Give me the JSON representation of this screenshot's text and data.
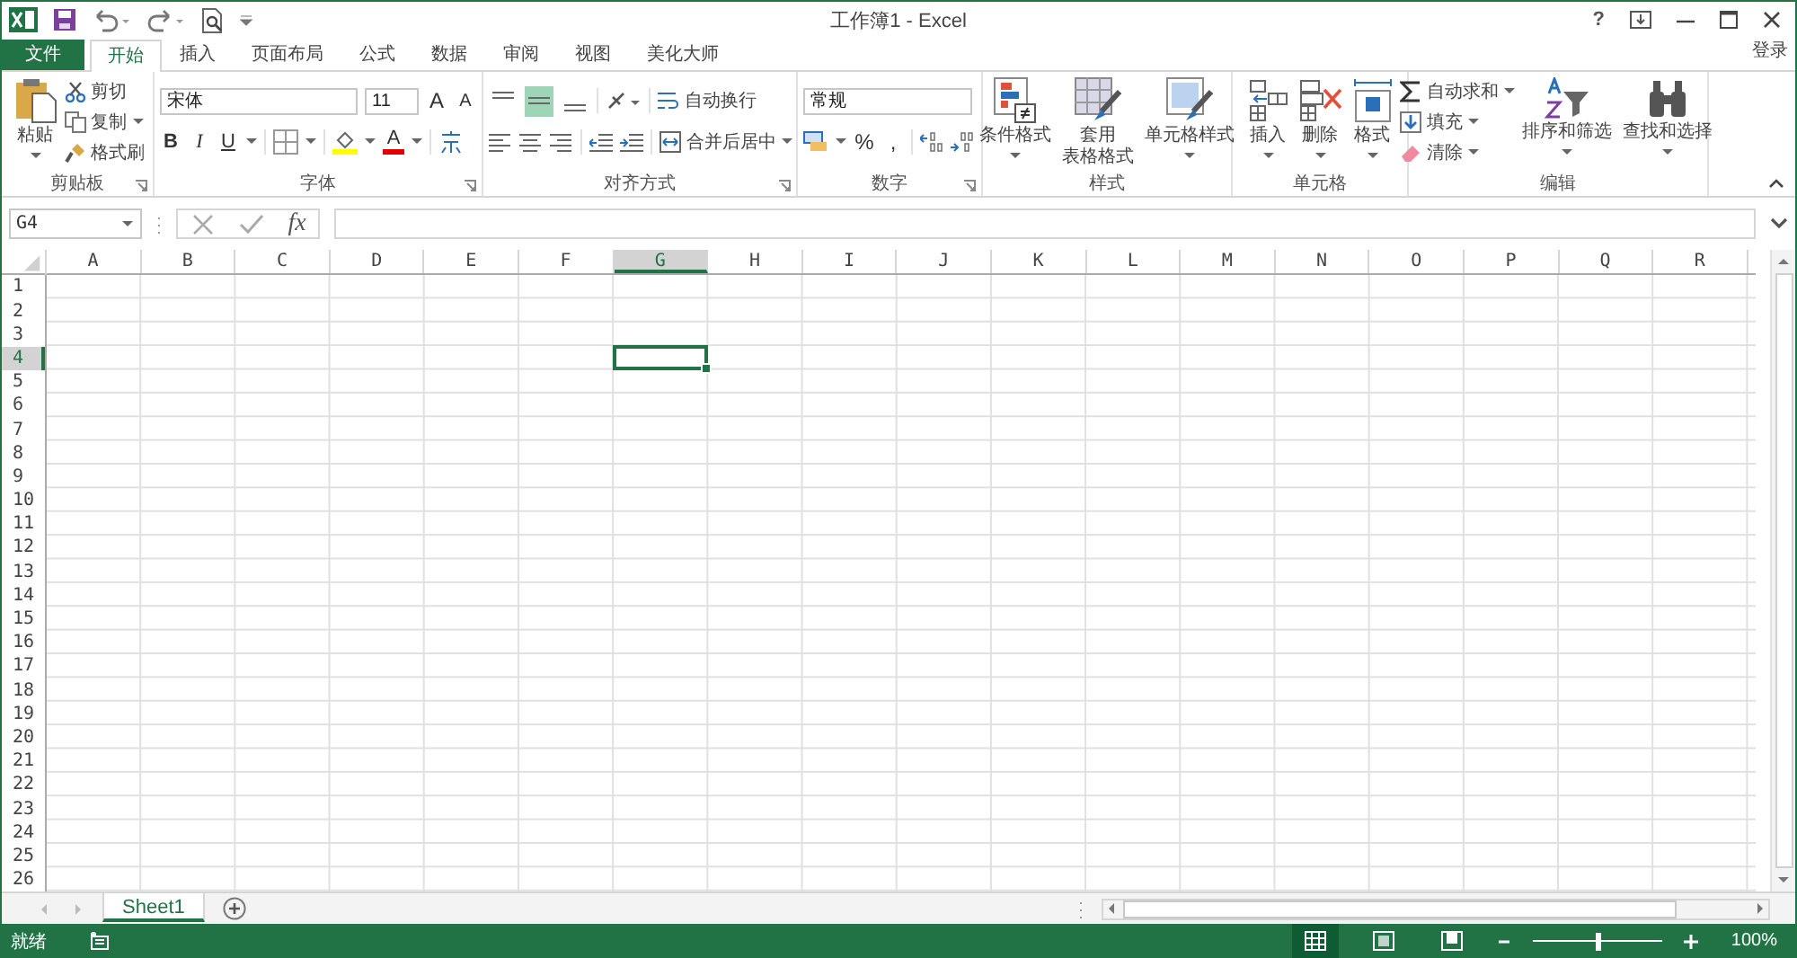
{
  "window": {
    "title": "工作簿1 - Excel",
    "help": "?",
    "signin": "登录"
  },
  "tabs": [
    {
      "label": "文件",
      "kind": "file",
      "selected": false
    },
    {
      "label": "开始",
      "kind": "tab",
      "selected": true
    },
    {
      "label": "插入",
      "kind": "tab",
      "selected": false
    },
    {
      "label": "页面布局",
      "kind": "tab",
      "selected": false
    },
    {
      "label": "公式",
      "kind": "tab",
      "selected": false
    },
    {
      "label": "数据",
      "kind": "tab",
      "selected": false
    },
    {
      "label": "审阅",
      "kind": "tab",
      "selected": false
    },
    {
      "label": "视图",
      "kind": "tab",
      "selected": false
    },
    {
      "label": "美化大师",
      "kind": "tab",
      "selected": false
    }
  ],
  "clipboard": {
    "label": "剪贴板",
    "paste": "粘贴",
    "cut": "剪切",
    "copy": "复制",
    "format_painter": "格式刷"
  },
  "font": {
    "label": "字体",
    "font_name": "宋体",
    "font_size": "11",
    "grow": "A",
    "shrink": "A",
    "bold": "B",
    "italic": "I",
    "underline": "U",
    "font_color": "A"
  },
  "alignment": {
    "label": "对齐方式",
    "vertical": [
      {
        "kind": "top",
        "selected": false
      },
      {
        "kind": "middle",
        "selected": true
      },
      {
        "kind": "bottom",
        "selected": false
      }
    ],
    "wrap": "自动换行",
    "merge": "合并后居中"
  },
  "number": {
    "label": "数字",
    "format": "常规",
    "percent": "%",
    "comma": ","
  },
  "styles": {
    "label": "样式",
    "conditional": "条件格式",
    "table": [
      "套用",
      "表格格式"
    ],
    "cell_styles": "单元格样式"
  },
  "cells": {
    "label": "单元格",
    "insert": "插入",
    "delete": "删除",
    "format": "格式"
  },
  "editing": {
    "label": "编辑",
    "autosum": "自动求和",
    "fill": "填充",
    "clear": "清除",
    "sort": "排序和筛选",
    "find": "查找和选择"
  },
  "formula_bar": {
    "name_box": "G4",
    "fx": "fx"
  },
  "columns": [
    {
      "label": "A",
      "selected": false
    },
    {
      "label": "B",
      "selected": false
    },
    {
      "label": "C",
      "selected": false
    },
    {
      "label": "D",
      "selected": false
    },
    {
      "label": "E",
      "selected": false
    },
    {
      "label": "F",
      "selected": false
    },
    {
      "label": "G",
      "selected": true
    },
    {
      "label": "H",
      "selected": false
    },
    {
      "label": "I",
      "selected": false
    },
    {
      "label": "J",
      "selected": false
    },
    {
      "label": "K",
      "selected": false
    },
    {
      "label": "L",
      "selected": false
    },
    {
      "label": "M",
      "selected": false
    },
    {
      "label": "N",
      "selected": false
    },
    {
      "label": "O",
      "selected": false
    },
    {
      "label": "P",
      "selected": false
    },
    {
      "label": "Q",
      "selected": false
    },
    {
      "label": "R",
      "selected": false
    }
  ],
  "rows": [
    {
      "label": "1",
      "selected": false
    },
    {
      "label": "2",
      "selected": false
    },
    {
      "label": "3",
      "selected": false
    },
    {
      "label": "4",
      "selected": true
    },
    {
      "label": "5",
      "selected": false
    },
    {
      "label": "6",
      "selected": false
    },
    {
      "label": "7",
      "selected": false
    },
    {
      "label": "8",
      "selected": false
    },
    {
      "label": "9",
      "selected": false
    },
    {
      "label": "10",
      "selected": false
    },
    {
      "label": "11",
      "selected": false
    },
    {
      "label": "12",
      "selected": false
    },
    {
      "label": "13",
      "selected": false
    },
    {
      "label": "14",
      "selected": false
    },
    {
      "label": "15",
      "selected": false
    },
    {
      "label": "16",
      "selected": false
    },
    {
      "label": "17",
      "selected": false
    },
    {
      "label": "18",
      "selected": false
    },
    {
      "label": "19",
      "selected": false
    },
    {
      "label": "20",
      "selected": false
    },
    {
      "label": "21",
      "selected": false
    },
    {
      "label": "22",
      "selected": false
    },
    {
      "label": "23",
      "selected": false
    },
    {
      "label": "24",
      "selected": false
    },
    {
      "label": "25",
      "selected": false
    },
    {
      "label": "26",
      "selected": false
    }
  ],
  "sheets": [
    {
      "label": "Sheet1",
      "selected": true
    }
  ],
  "status": {
    "text": "就绪",
    "views": [
      {
        "kind": "normal",
        "selected": true
      },
      {
        "kind": "page_layout",
        "selected": false
      },
      {
        "kind": "page_break",
        "selected": false
      }
    ],
    "zoom": {
      "level": 0.5,
      "reading": "100%"
    }
  }
}
